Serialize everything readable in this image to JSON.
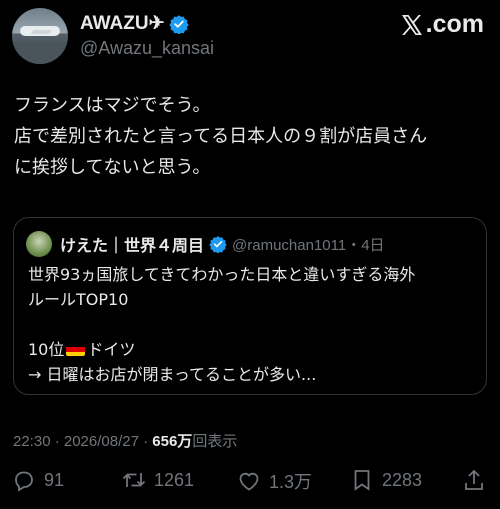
{
  "author": {
    "display_name": "AWAZU✈",
    "handle": "@Awazu_kansai"
  },
  "brand": {
    "label": ".com"
  },
  "tweet": {
    "lines": [
      "フランスはマジでそう。",
      "店で差別されたと言ってる日本人の９割が店員さん",
      "に挨拶してないと思う。"
    ]
  },
  "quote": {
    "name": "けえた｜世界４周目",
    "handle_time": "@ramuchan1011・4日",
    "line1": "世界93ヵ国旅してきてわかった日本と違いすぎる海外",
    "line2": "ルールTOP10",
    "rank": "10位",
    "country": "ドイツ",
    "line4": "→ 日曜はお店が閉まってることが多い..."
  },
  "meta": {
    "time_date": "22:30 · 2026/08/27 · ",
    "views_count": "656万",
    "views_label": "回表示"
  },
  "actions": {
    "replies": "91",
    "reposts": "1261",
    "likes": "1.3万",
    "bookmarks": "2283"
  },
  "colors": {
    "background": "#000000",
    "text": "#e7e9ea",
    "muted": "#71767b",
    "verified": "#1d9bf0",
    "border": "#2f3336"
  }
}
